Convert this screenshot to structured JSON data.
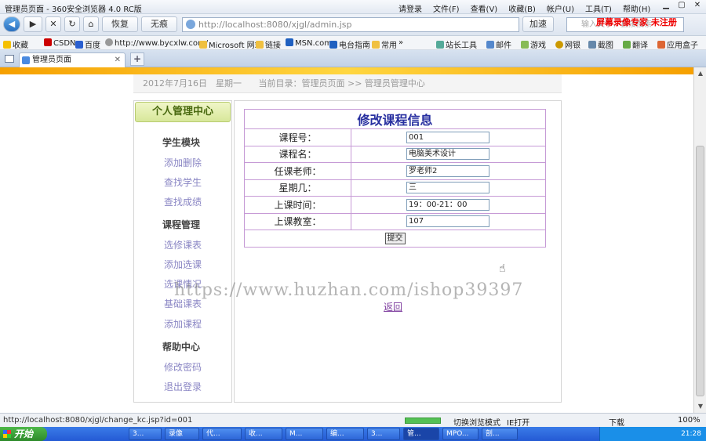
{
  "titlebar": {
    "title": "管理员页面 - 360安全浏览器 4.0 RC版",
    "menus": [
      "请登录",
      "文件(F)",
      "查看(V)",
      "收藏(B)",
      "帐户(U)",
      "工具(T)",
      "帮助(H)"
    ],
    "watermark": "屏幕录像专家 未注册"
  },
  "nav": {
    "back": "◀",
    "forward": "▶",
    "stop": "✕",
    "refresh": "↻",
    "home": "⌂",
    "undo": "恢复",
    "trace": "无痕",
    "url": "http://localhost:8080/xjgl/admin.jsp",
    "speed": "加速",
    "search_placeholder": "输入文字，直接搜索"
  },
  "favorites": {
    "items": [
      "收藏",
      "CSDN",
      "百度",
      "http://www.bycxlw.com/",
      "Microsoft 网站",
      "链接",
      "MSN.com",
      "电台指南",
      "常用",
      "»"
    ],
    "right": [
      "站长工具",
      "邮件",
      "游戏",
      "网银",
      "截图",
      "翻译",
      "应用盒子"
    ]
  },
  "tab": {
    "label": "管理员页面"
  },
  "page": {
    "date": "2012年7月16日　星期一",
    "location": "当前目录：管理员页面 >> 管理员管理中心",
    "sidebar": {
      "title": "个人管理中心",
      "groups": [
        {
          "name": "学生模块",
          "links": [
            "添加删除",
            "查找学生",
            "查找成绩"
          ]
        },
        {
          "name": "课程管理",
          "links": [
            "选修课表",
            "添加选课",
            "选课情况",
            "基础课表",
            "添加课程"
          ]
        },
        {
          "name": "帮助中心",
          "links": [
            "修改密码",
            "退出登录"
          ]
        }
      ]
    },
    "form": {
      "caption": "修改课程信息",
      "fields": [
        {
          "label": "课程号：",
          "value": "001"
        },
        {
          "label": "课程名：",
          "value": "电脑美术设计"
        },
        {
          "label": "任课老师：",
          "value": "罗老师2"
        },
        {
          "label": "星期几：",
          "value": "三"
        },
        {
          "label": "上课时间：",
          "value": "19：00-21：00"
        },
        {
          "label": "上课教室：",
          "value": "107"
        }
      ],
      "submit": "提交"
    },
    "back_link": "返回",
    "watermark": "https://www.huzhan.com/ishop39397"
  },
  "status": {
    "url": "http://localhost:8080/xjgl/change_kc.jsp?id=001",
    "mode": "切换浏览模式",
    "ie": "IE打开",
    "download": "下载",
    "zoom": "100%"
  },
  "taskbar": {
    "start": "开始",
    "items": [
      "3...",
      "录像",
      "代...",
      "收...",
      "M...",
      "编...",
      "3...",
      "管...",
      "MPO...",
      "剖..."
    ],
    "clock": "21:28"
  },
  "colors": {
    "link": "#8a86c4",
    "caption": "#2830a0",
    "border": "#c69ad6",
    "accent": "#f6a000"
  }
}
